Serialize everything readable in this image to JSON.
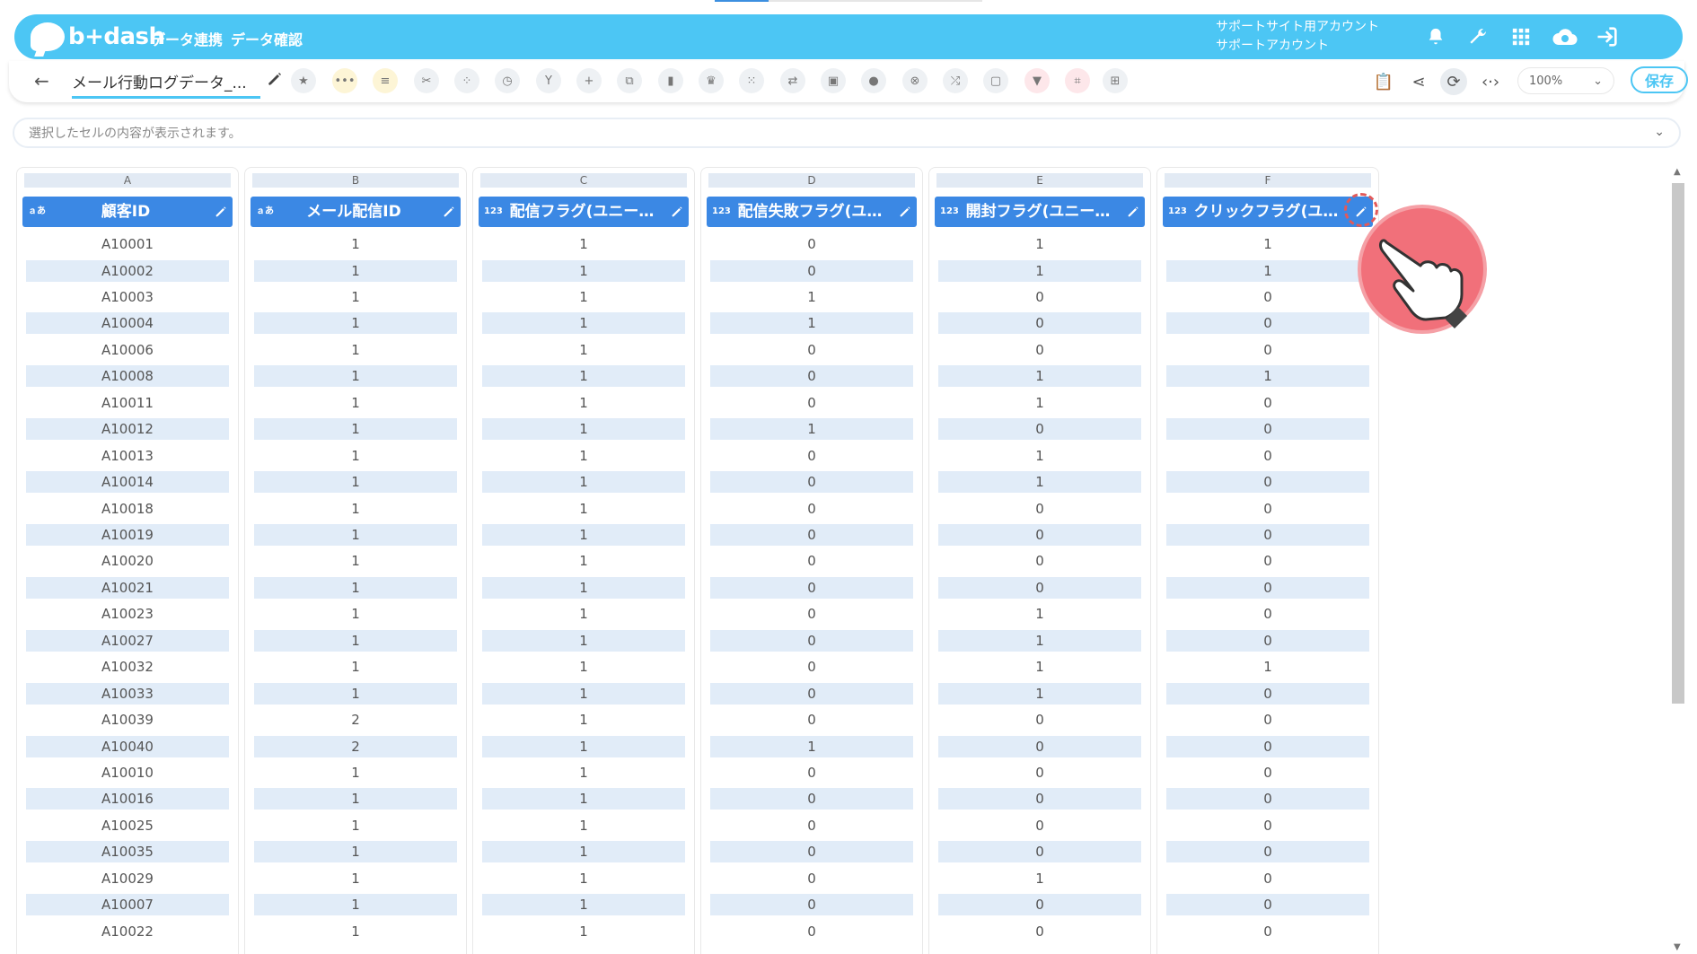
{
  "app": {
    "logo_text": "b+dash",
    "nav": [
      "データ連携",
      "データ確認"
    ],
    "account_line1": "サポートサイト用アカウント",
    "account_line2": "サポートアカウント"
  },
  "toolbar": {
    "dataset_name": "メール行動ログデータ_...",
    "zoom": "100%",
    "save_label": "保存"
  },
  "cellbar": {
    "placeholder": "選択したセルの内容が表示されます。"
  },
  "columns": [
    {
      "letter": "A",
      "type": "ａあ",
      "name": "顧客ID"
    },
    {
      "letter": "B",
      "type": "ａあ",
      "name": "メール配信ID"
    },
    {
      "letter": "C",
      "type": "123",
      "name": "配信フラグ(ユニー…"
    },
    {
      "letter": "D",
      "type": "123",
      "name": "配信失敗フラグ(ユ…"
    },
    {
      "letter": "E",
      "type": "123",
      "name": "開封フラグ(ユニー…"
    },
    {
      "letter": "F",
      "type": "123",
      "name": "クリックフラグ(ユ…"
    }
  ],
  "rows": [
    [
      "A10001",
      "1",
      "1",
      "0",
      "1",
      "1"
    ],
    [
      "A10002",
      "1",
      "1",
      "0",
      "1",
      "1"
    ],
    [
      "A10003",
      "1",
      "1",
      "1",
      "0",
      "0"
    ],
    [
      "A10004",
      "1",
      "1",
      "1",
      "0",
      "0"
    ],
    [
      "A10006",
      "1",
      "1",
      "0",
      "0",
      "0"
    ],
    [
      "A10008",
      "1",
      "1",
      "0",
      "1",
      "1"
    ],
    [
      "A10011",
      "1",
      "1",
      "0",
      "1",
      "0"
    ],
    [
      "A10012",
      "1",
      "1",
      "1",
      "0",
      "0"
    ],
    [
      "A10013",
      "1",
      "1",
      "0",
      "1",
      "0"
    ],
    [
      "A10014",
      "1",
      "1",
      "0",
      "1",
      "0"
    ],
    [
      "A10018",
      "1",
      "1",
      "0",
      "0",
      "0"
    ],
    [
      "A10019",
      "1",
      "1",
      "0",
      "0",
      "0"
    ],
    [
      "A10020",
      "1",
      "1",
      "0",
      "0",
      "0"
    ],
    [
      "A10021",
      "1",
      "1",
      "0",
      "0",
      "0"
    ],
    [
      "A10023",
      "1",
      "1",
      "0",
      "1",
      "0"
    ],
    [
      "A10027",
      "1",
      "1",
      "0",
      "1",
      "0"
    ],
    [
      "A10032",
      "1",
      "1",
      "0",
      "1",
      "1"
    ],
    [
      "A10033",
      "1",
      "1",
      "0",
      "1",
      "0"
    ],
    [
      "A10039",
      "2",
      "1",
      "0",
      "0",
      "0"
    ],
    [
      "A10040",
      "2",
      "1",
      "1",
      "0",
      "0"
    ],
    [
      "A10010",
      "1",
      "1",
      "0",
      "0",
      "0"
    ],
    [
      "A10016",
      "1",
      "1",
      "0",
      "0",
      "0"
    ],
    [
      "A10025",
      "1",
      "1",
      "0",
      "0",
      "0"
    ],
    [
      "A10035",
      "1",
      "1",
      "0",
      "0",
      "0"
    ],
    [
      "A10029",
      "1",
      "1",
      "0",
      "1",
      "0"
    ],
    [
      "A10007",
      "1",
      "1",
      "0",
      "0",
      "0"
    ],
    [
      "A10022",
      "1",
      "1",
      "0",
      "0",
      "0"
    ]
  ],
  "icons": {
    "toolbar": [
      "star-icon",
      "more-icon",
      "note-icon",
      "scissors-icon",
      "split-icon",
      "timer-icon",
      "merge-icon",
      "add-icon",
      "copy-icon",
      "delete-icon",
      "crown-icon",
      "expand-icon",
      "replace-icon",
      "lock-icon",
      "bag-icon",
      "close-circle-icon",
      "shuffle-icon",
      "frame-icon",
      "filter-icon",
      "group-icon",
      "grid-icon"
    ],
    "header": [
      "bell-icon",
      "wrench-icon",
      "apps-icon",
      "cloud-icon",
      "logout-icon"
    ]
  },
  "colors": {
    "header": "#4cc6f4",
    "column_header": "#3b88e4",
    "alt_row": "#e1ecf8",
    "pointer": "#f1707a"
  }
}
